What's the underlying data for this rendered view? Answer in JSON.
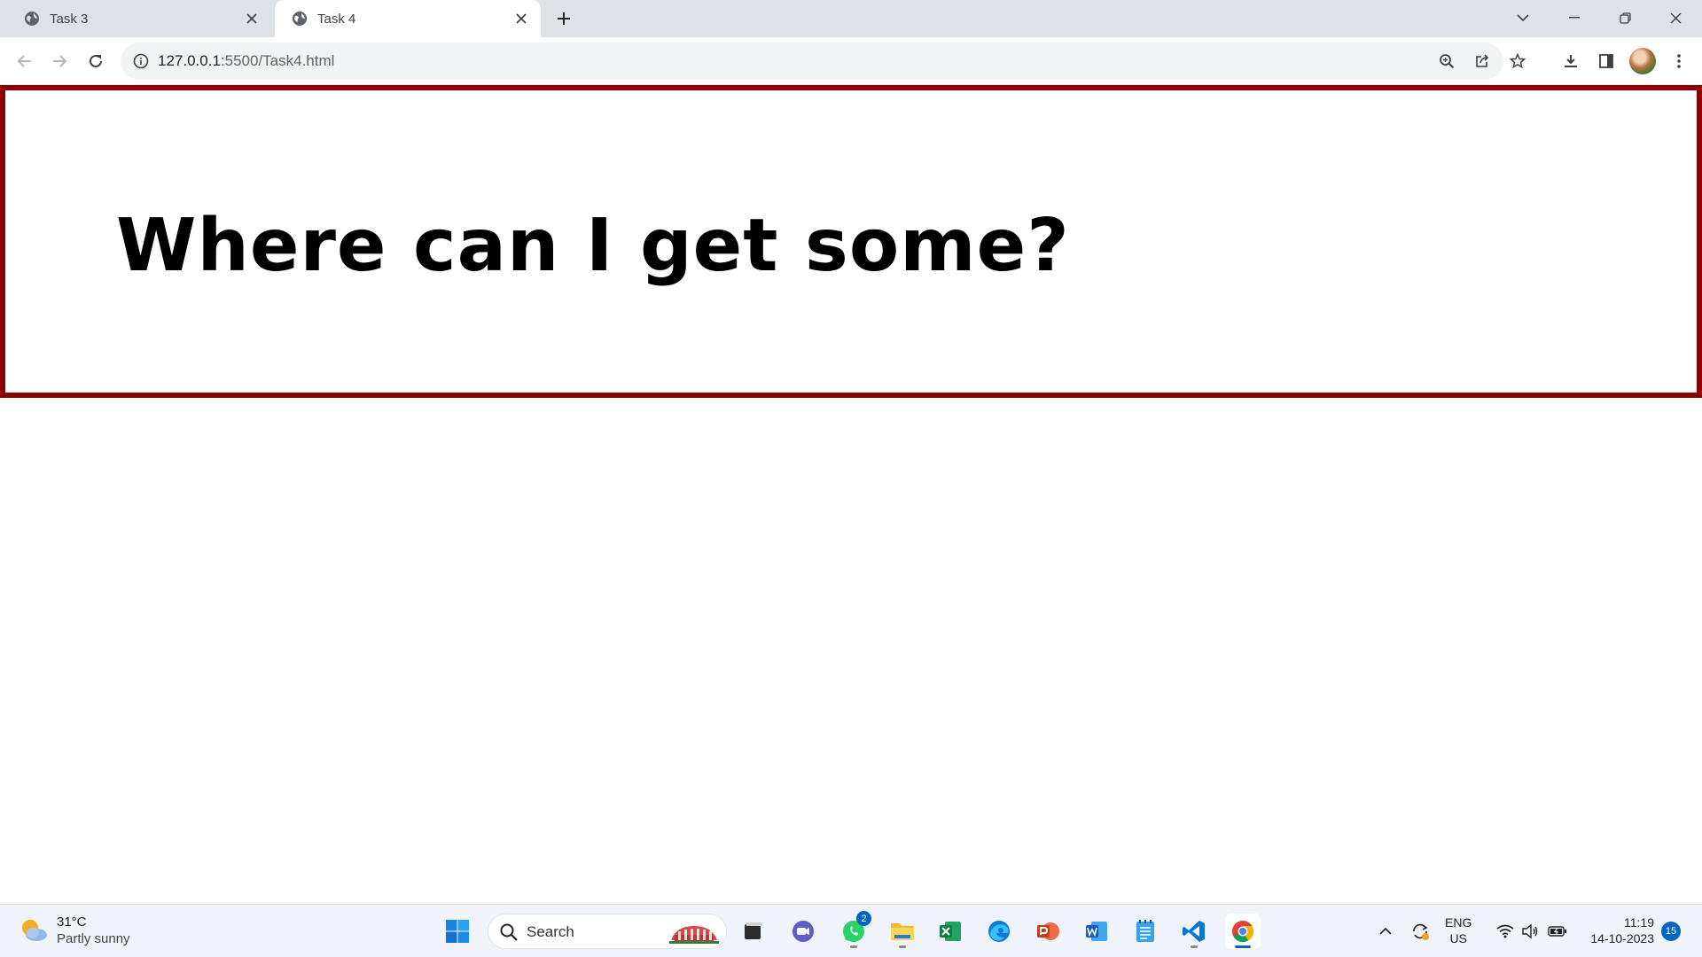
{
  "browser": {
    "tabs": [
      {
        "label": "Task 3",
        "active": false
      },
      {
        "label": "Task 4",
        "active": true
      }
    ],
    "address": {
      "host": "127.0.0.1",
      "rest": ":5500/Task4.html"
    }
  },
  "page": {
    "heading": "Where can I get some?",
    "border_color": "#8b0000"
  },
  "taskbar": {
    "weather": {
      "temp": "31°C",
      "condition": "Partly sunny"
    },
    "search_label": "Search",
    "whatsapp_badge": "2",
    "language": {
      "line1": "ENG",
      "line2": "US"
    },
    "clock": {
      "time": "11:19",
      "date": "14-10-2023"
    },
    "notifications": "15",
    "apps": [
      "start",
      "search",
      "file-explorer-dark",
      "teams",
      "whatsapp",
      "file-explorer",
      "excel",
      "edge",
      "powerpoint",
      "word",
      "notepad",
      "vscode",
      "chrome"
    ]
  },
  "colors": {
    "accent": "#0067c0",
    "tabstrip": "#dee1e6"
  }
}
